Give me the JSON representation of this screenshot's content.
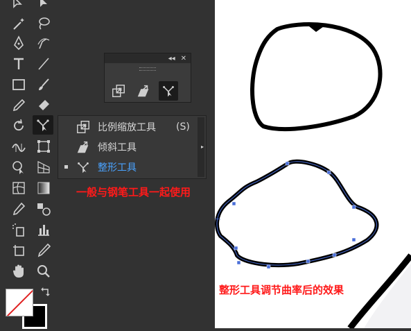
{
  "toolbar": {
    "tools": [
      {
        "name": "direct-selection-tool-icon"
      },
      {
        "name": "group-selection-tool-icon"
      },
      {
        "name": "magic-wand-tool-icon"
      },
      {
        "name": "lasso-tool-icon"
      },
      {
        "name": "pen-tool-icon"
      },
      {
        "name": "curvature-tool-icon"
      },
      {
        "name": "type-tool-icon"
      },
      {
        "name": "line-segment-tool-icon"
      },
      {
        "name": "rectangle-tool-icon"
      },
      {
        "name": "paintbrush-tool-icon"
      },
      {
        "name": "pencil-tool-icon"
      },
      {
        "name": "eraser-tool-icon"
      },
      {
        "name": "rotate-tool-icon"
      },
      {
        "name": "reshape-tool-icon"
      },
      {
        "name": "width-tool-icon"
      },
      {
        "name": "free-transform-tool-icon"
      },
      {
        "name": "shape-builder-tool-icon"
      },
      {
        "name": "perspective-grid-tool-icon"
      },
      {
        "name": "mesh-tool-icon"
      },
      {
        "name": "gradient-tool-icon"
      },
      {
        "name": "eyedropper-tool-icon"
      },
      {
        "name": "blend-tool-icon"
      },
      {
        "name": "symbol-sprayer-tool-icon"
      },
      {
        "name": "column-graph-tool-icon"
      },
      {
        "name": "artboard-tool-icon"
      },
      {
        "name": "slice-tool-icon"
      },
      {
        "name": "hand-tool-icon"
      },
      {
        "name": "zoom-tool-icon"
      }
    ]
  },
  "floating_panel": {
    "header_icons": [
      "collapse-icon",
      "close-icon"
    ],
    "header_collapse": "◂◂",
    "header_close": "✕",
    "tools": [
      "scale-tool-icon",
      "shear-tool-icon",
      "reshape-tool-icon"
    ]
  },
  "flyout": {
    "items": [
      {
        "label": "比例缩放工具",
        "shortcut": "(S)",
        "icon": "scale-tool-icon"
      },
      {
        "label": "倾斜工具",
        "shortcut": "",
        "icon": "shear-tool-icon"
      },
      {
        "label": "整形工具",
        "shortcut": "",
        "icon": "reshape-tool-icon",
        "current": true
      }
    ]
  },
  "annotations": {
    "use_with_pen": "一般与钢笔工具一起使用",
    "effect": "整形工具调节曲率后的效果"
  },
  "colors": {
    "ui_bg": "#323232",
    "accent_blue": "#4aa3ff",
    "annotation_red": "#ff1a1a",
    "path_selected": "#4a6fd8"
  }
}
